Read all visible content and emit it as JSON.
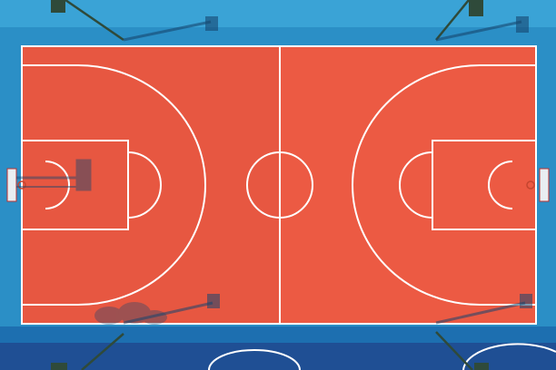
{
  "scene": {
    "subject": "basketball-court-aerial",
    "colors": {
      "surround": "#2b8fc6",
      "surround_light": "#3aa3d6",
      "court": "#ec5a43",
      "court_shade": "#d8503c",
      "lines": "#ffffff",
      "lower_court": "#1f4f94",
      "lower_band": "#1d6fb0",
      "hoop_post": "#2f4a3a",
      "shadow": "#16466f"
    }
  }
}
